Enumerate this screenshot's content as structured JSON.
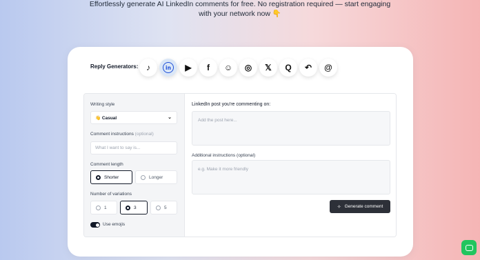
{
  "hero": {
    "line1": "Effortlessly generate AI LinkedIn comments for free. No registration required — start engaging",
    "line2": "with your network now 👇"
  },
  "generators": {
    "label": "Reply Generators:",
    "icons": [
      {
        "name": "tiktok-icon",
        "glyph": "♪",
        "active": false
      },
      {
        "name": "linkedin-icon",
        "glyph": "in",
        "active": true
      },
      {
        "name": "youtube-icon",
        "glyph": "▶",
        "active": false
      },
      {
        "name": "facebook-icon",
        "glyph": "f",
        "active": false
      },
      {
        "name": "reddit-icon",
        "glyph": "☺",
        "active": false
      },
      {
        "name": "instagram-icon",
        "glyph": "◎",
        "active": false
      },
      {
        "name": "x-icon",
        "glyph": "𝕏",
        "active": false
      },
      {
        "name": "quora-icon",
        "glyph": "Q",
        "active": false
      },
      {
        "name": "reply-icon",
        "glyph": "↶",
        "active": false
      },
      {
        "name": "at-icon",
        "glyph": "@",
        "active": false
      }
    ]
  },
  "form": {
    "writing_style_label": "Writing style",
    "writing_style_value": "👋 Casual",
    "comment_instructions_label": "Comment instructions",
    "optional_tag": "(optional)",
    "comment_instructions_placeholder": "What I want to say is...",
    "comment_length_label": "Comment length",
    "length_options": [
      "Shorter",
      "Longer"
    ],
    "length_selected": "Shorter",
    "variations_label": "Number of variations",
    "variation_options": [
      "1",
      "3",
      "5"
    ],
    "variation_selected": "3",
    "emoji_label": "Use emojis",
    "emoji_enabled": true,
    "post_label": "LinkedIn post you're commenting on:",
    "post_placeholder": "Add the post here...",
    "additional_label": "Additional instructions (optional)",
    "additional_placeholder": "e.g. Make it more friendly",
    "generate_label": "Generate comment"
  },
  "colors": {
    "accent_dark": "#2d3038",
    "linkedin_blue": "#1d4ed8",
    "chat_green": "#22c55e"
  }
}
